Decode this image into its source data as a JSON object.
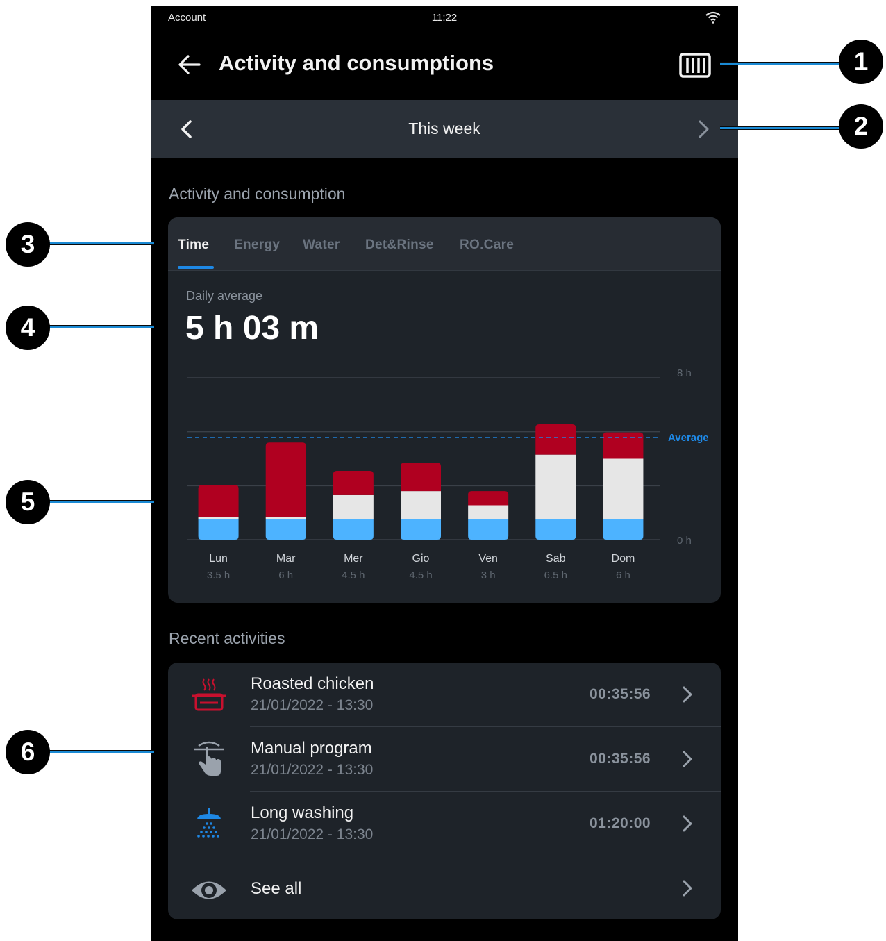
{
  "status_bar": {
    "left": "Account",
    "time": "11:22",
    "wifi_icon": "wifi-icon"
  },
  "app_bar": {
    "title": "Activity and consumptions",
    "back_icon": "arrow-left-icon",
    "action_icon": "appliance-settings-icon"
  },
  "period_selector": {
    "label": "This week",
    "prev_icon": "chevron-left-icon",
    "next_icon": "chevron-right-icon"
  },
  "activity_section": {
    "title": "Activity and consumption",
    "tabs": [
      "Time",
      "Energy",
      "Water",
      "Det&Rinse",
      "RO.Care"
    ],
    "active_tab": "Time",
    "daily_average_label": "Daily average",
    "daily_average_value": "5 h 03 m"
  },
  "chart_data": {
    "type": "bar",
    "stacked": true,
    "categories": [
      "Lun",
      "Mar",
      "Mer",
      "Gio",
      "Ven",
      "Sab",
      "Dom"
    ],
    "category_totals": [
      "3.5 h",
      "6 h",
      "4.5 h",
      "4.5 h",
      "3 h",
      "6.5 h",
      "6 h"
    ],
    "series": [
      {
        "color": "#4db3ff",
        "values": [
          1.0,
          1.0,
          1.0,
          1.0,
          1.0,
          1.0,
          1.0
        ]
      },
      {
        "color": "#e6e6e6",
        "values": [
          0.1,
          0.1,
          1.2,
          1.4,
          0.7,
          3.2,
          3.0
        ]
      },
      {
        "color": "#b00020",
        "values": [
          1.6,
          3.7,
          1.2,
          1.4,
          0.7,
          1.5,
          1.3
        ]
      }
    ],
    "ylim": [
      0,
      8
    ],
    "y_tick_labels": [
      "8 h",
      "0 h"
    ],
    "average_value": 5.05,
    "average_label": "Average",
    "average_color": "#1e88e5",
    "grid": true
  },
  "recent_section": {
    "title": "Recent activities",
    "items": [
      {
        "title": "Roasted chicken",
        "date": "21/01/2022 - 13:30",
        "duration": "00:35:56",
        "icon": "roasting-pan-icon",
        "icon_color": "#c8102e"
      },
      {
        "title": "Manual program",
        "date": "21/01/2022 - 13:30",
        "duration": "00:35:56",
        "icon": "touch-hand-icon",
        "icon_color": "#9aa2ac"
      },
      {
        "title": "Long washing",
        "date": "21/01/2022 - 13:30",
        "duration": "01:20:00",
        "icon": "shower-icon",
        "icon_color": "#1e88e5"
      }
    ],
    "see_all": {
      "label": "See all",
      "icon": "eye-icon"
    }
  },
  "callouts": [
    "1",
    "2",
    "3",
    "4",
    "5",
    "6"
  ],
  "colors": {
    "background": "#000000",
    "card": "#1e2329",
    "accent": "#1e88e5",
    "callout_line": "#1a8ad4"
  }
}
